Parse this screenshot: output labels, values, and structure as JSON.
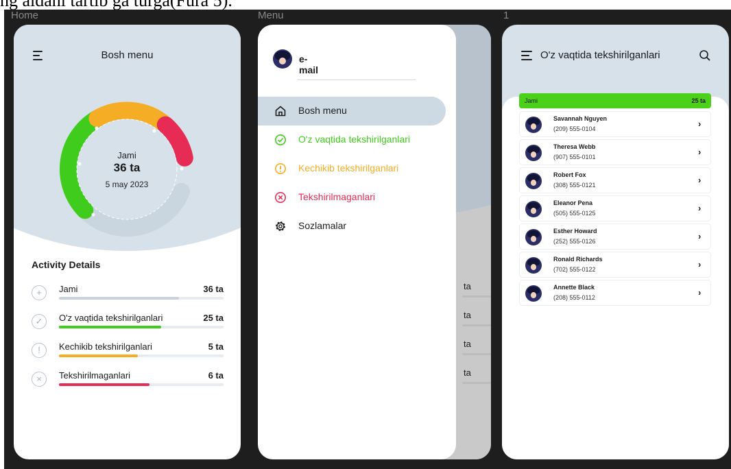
{
  "caption": "ng aldani tartib ga turga(Fura 5).",
  "frames": {
    "home_label": "Home",
    "menu_label": "Menu",
    "list_label": "1"
  },
  "colors": {
    "green": "#3fcc1c",
    "orange": "#f4ad24",
    "red": "#e62c55",
    "track": "#c9d5df",
    "hero": "#d6e1ea"
  },
  "home": {
    "title": "Bosh menu",
    "donut": {
      "total_label": "Jami",
      "total_value": "36 ta",
      "date": "5 may 2023"
    },
    "activity_title": "Activity Details",
    "activities": [
      {
        "icon": "plus-icon",
        "label": "Jami",
        "value": "36 ta",
        "progress": 0.73,
        "color": "#c6d3df"
      },
      {
        "icon": "check-icon",
        "label": "O'z vaqtida tekshirilganlari",
        "value": "25 ta",
        "progress": 0.62,
        "color": "#3fcc1c"
      },
      {
        "icon": "exclamation-icon",
        "label": "Kechikib tekshirilganlari",
        "value": "5 ta",
        "progress": 0.48,
        "color": "#f4ad24"
      },
      {
        "icon": "x-icon",
        "label": "Tekshirilmaganlari",
        "value": "6 ta",
        "progress": 0.55,
        "color": "#e62c55"
      }
    ]
  },
  "menu": {
    "email": "e-mail",
    "items": [
      {
        "icon": "home-icon",
        "label": "Bosh menu",
        "color": "#1a1a1a",
        "active": true
      },
      {
        "icon": "check-circle-icon",
        "label": "O'z vaqtida tekshirilganlari",
        "color": "#3fcc1c",
        "active": false
      },
      {
        "icon": "exclamation-circle-icon",
        "label": "Kechikib tekshirilganlari",
        "color": "#f4ad24",
        "active": false
      },
      {
        "icon": "x-circle-icon",
        "label": "Tekshirilmaganlari",
        "color": "#e62c55",
        "active": false
      },
      {
        "icon": "gear-icon",
        "label": "Sozlamalar",
        "color": "#1a1a1a",
        "active": false
      }
    ],
    "behind_values": [
      "ta",
      "ta",
      "ta",
      "ta"
    ]
  },
  "list": {
    "title": "O'z vaqtida tekshirilganlari",
    "summary": {
      "label": "Jami",
      "value": "25 ta"
    },
    "contacts": [
      {
        "name": "Savannah Nguyen",
        "phone": "(209) 555-0104"
      },
      {
        "name": "Theresa Webb",
        "phone": "(907) 555-0101"
      },
      {
        "name": "Robert Fox",
        "phone": "(308) 555-0121"
      },
      {
        "name": "Eleanor Pena",
        "phone": "(505) 555-0125"
      },
      {
        "name": "Esther Howard",
        "phone": "(252) 555-0126"
      },
      {
        "name": "Ronald Richards",
        "phone": "(702) 555-0122"
      },
      {
        "name": "Annette Black",
        "phone": "(208) 555-0112"
      }
    ]
  }
}
